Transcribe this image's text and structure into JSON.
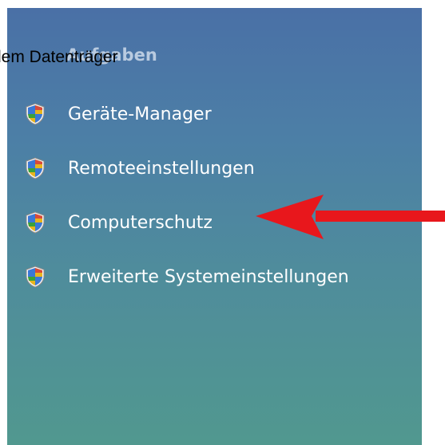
{
  "panel": {
    "heading": "Aufgaben",
    "overlay_caption": "dem Datenträger",
    "items": [
      {
        "label": "Geräte-Manager",
        "icon": "uac-shield-icon"
      },
      {
        "label": "Remoteeinstellungen",
        "icon": "uac-shield-icon"
      },
      {
        "label": "Computerschutz",
        "icon": "uac-shield-icon"
      },
      {
        "label": "Erweiterte Systemeinstellungen",
        "icon": "uac-shield-icon"
      }
    ]
  },
  "annotation": {
    "arrow_color": "#e8171c",
    "points_to": "Computerschutz"
  },
  "colors": {
    "panel_top": "#4a70a6",
    "panel_bottom": "#51988f",
    "link_text": "#ffffff"
  }
}
